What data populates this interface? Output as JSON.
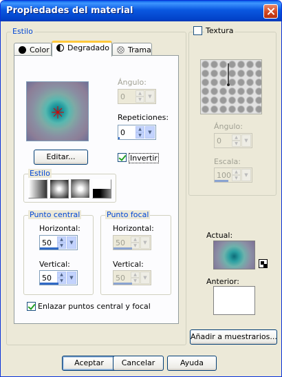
{
  "window": {
    "title": "Propiedades del material"
  },
  "estilo_group": {
    "label": "Estilo"
  },
  "tabs": [
    {
      "label": "Color",
      "icon": "black-circle-icon"
    },
    {
      "label": "Degradado",
      "icon": "half-circle-icon"
    },
    {
      "label": "Trama",
      "icon": "pattern-icon"
    }
  ],
  "gradient_panel": {
    "angle_label": "Ángulo:",
    "angle_value": "0",
    "repeat_label": "Repeticiones:",
    "repeat_value": "0",
    "edit_button": "Editar...",
    "invert_label": "Invertir",
    "invert_checked": true,
    "style_group_label": "Estilo",
    "style_buttons": [
      "linear-style-icon",
      "rectangular-style-icon",
      "sunburst-style-icon",
      "radial-style-icon"
    ],
    "center_group_label": "Punto central",
    "center_horizontal_label": "Horizontal:",
    "center_horizontal_value": "50",
    "center_vertical_label": "Vertical:",
    "center_vertical_value": "50",
    "focal_group_label": "Punto focal",
    "focal_horizontal_label": "Horizontal:",
    "focal_horizontal_value": "50",
    "focal_vertical_label": "Vertical:",
    "focal_vertical_value": "50",
    "link_label": "Enlazar puntos central y focal",
    "link_checked": true
  },
  "texture": {
    "label": "Textura",
    "checked": false,
    "angle_label": "Ángulo:",
    "angle_value": "0",
    "scale_label": "Escala:",
    "scale_value": "100"
  },
  "swatches": {
    "actual_label": "Actual:",
    "previous_label": "Anterior:",
    "add_button": "Añadir a muestrarios..."
  },
  "footer": {
    "ok": "Aceptar",
    "cancel": "Cancelar",
    "help": "Ayuda"
  },
  "colors": {
    "title_bar": "#0a58e0",
    "group_label": "#0046d5",
    "selected_tab_accent": "#ffc83c",
    "gradient_center": "#0d6b78",
    "gradient_edge": "#7e6f96"
  }
}
